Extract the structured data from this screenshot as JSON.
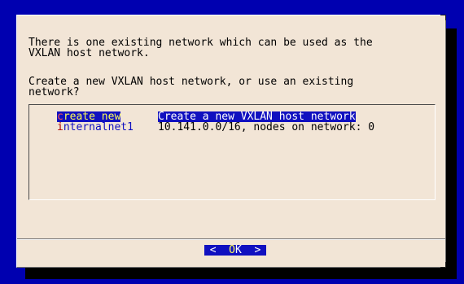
{
  "dialog": {
    "message_line1": "There is one existing network which can be used as the",
    "message_line2": "VXLAN host network.",
    "prompt_line1": "Create a new VXLAN host network, or use an existing",
    "prompt_line2": "network?"
  },
  "menu": {
    "items": [
      {
        "tag_hotkey": "c",
        "tag_rest": "reate new",
        "description": "Create a new VXLAN host network",
        "selected": true
      },
      {
        "tag_hotkey": "i",
        "tag_rest": "nternalnet1",
        "description": "10.141.0.0/16, nodes on network: 0",
        "selected": false
      }
    ]
  },
  "buttons": {
    "ok_left": "<  ",
    "ok_hotkey": "O",
    "ok_rest": "K",
    "ok_right": "  >"
  },
  "colors": {
    "screen_background": "#0000b0",
    "dialog_background": "#f2e5d6",
    "selection_background": "#1010c0",
    "selection_tag_text": "#ffff55",
    "hotkey": "#b00000"
  }
}
